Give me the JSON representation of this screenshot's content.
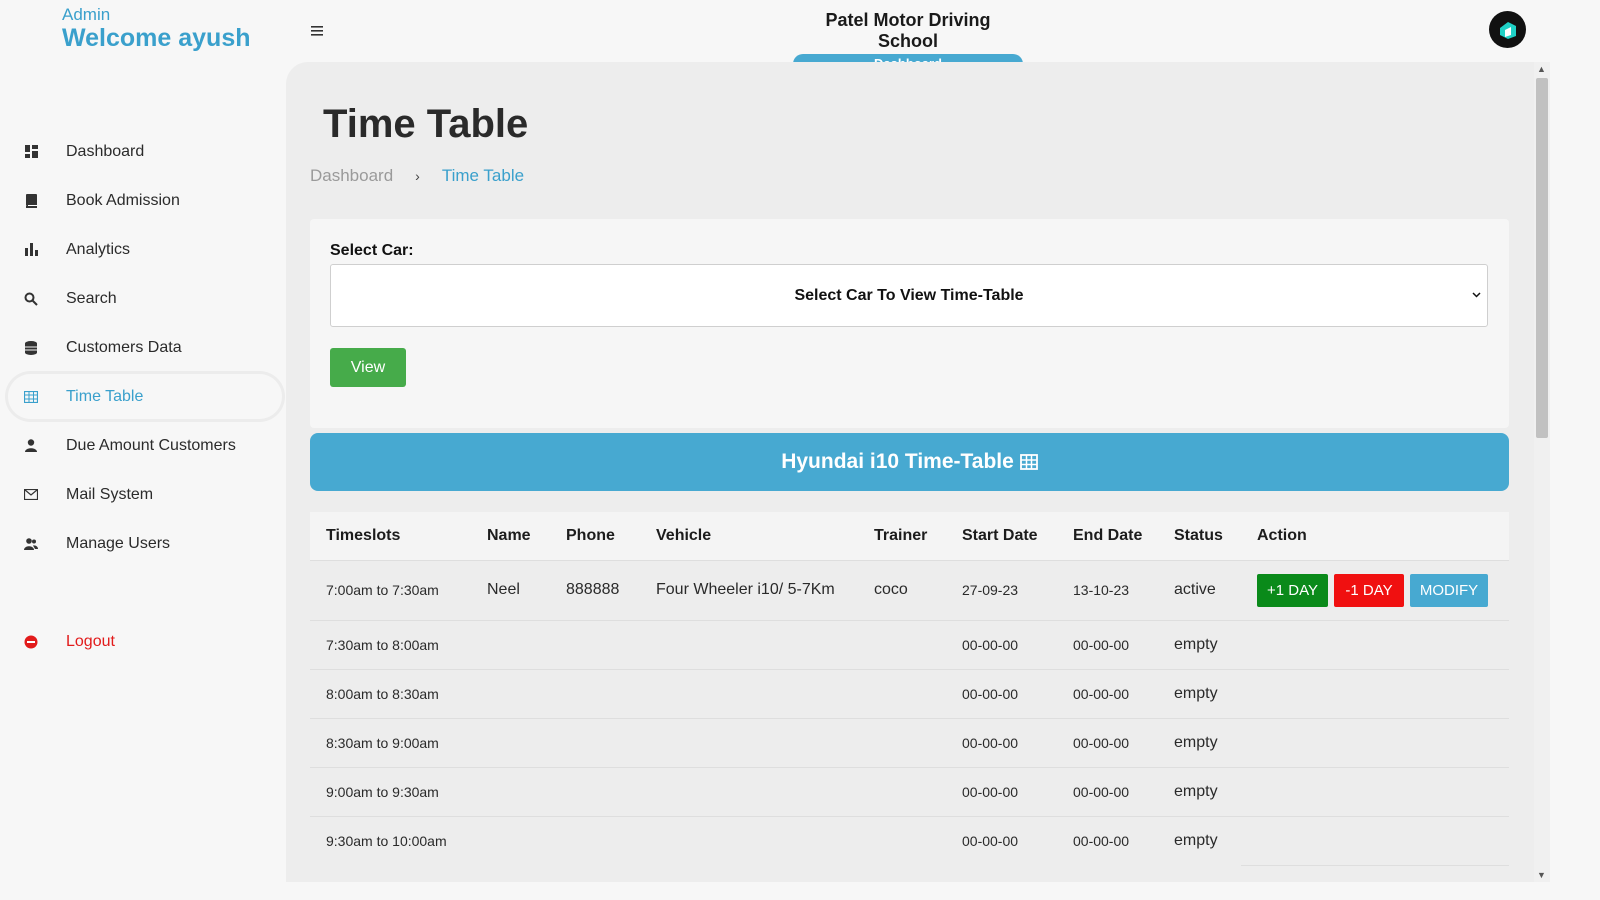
{
  "sidebar": {
    "role": "Admin",
    "welcome": "Welcome ayush",
    "items": [
      {
        "label": "Dashboard",
        "icon": "dashboard-icon"
      },
      {
        "label": "Book Admission",
        "icon": "book-icon"
      },
      {
        "label": "Analytics",
        "icon": "bar-chart-icon"
      },
      {
        "label": "Search",
        "icon": "search-icon"
      },
      {
        "label": "Customers Data",
        "icon": "database-icon"
      },
      {
        "label": "Time Table",
        "icon": "table-icon",
        "active": true
      },
      {
        "label": "Due Amount Customers",
        "icon": "person-icon"
      },
      {
        "label": "Mail System",
        "icon": "mail-icon"
      },
      {
        "label": "Manage Users",
        "icon": "users-icon"
      }
    ],
    "logout": "Logout"
  },
  "header": {
    "brand_title": "Patel Motor Driving School",
    "brand_sub": "Dashboard"
  },
  "main": {
    "page_title": "Time Table",
    "breadcrumb": [
      "Dashboard",
      "Time Table"
    ],
    "select_label": "Select Car:",
    "select_value": "Select Car To View Time-Table",
    "view_button": "View",
    "banner_title": "Hyundai i10 Time-Table"
  },
  "table": {
    "headers": [
      "Timeslots",
      "Name",
      "Phone",
      "Vehicle",
      "Trainer",
      "Start Date",
      "End Date",
      "Status",
      "Action"
    ],
    "rows": [
      {
        "slot": "7:00am to 7:30am",
        "name": "Neel",
        "phone": "888888",
        "vehicle": "Four Wheeler i10/ 5-7Km",
        "trainer": "coco",
        "start": "27-09-23",
        "end": "13-10-23",
        "status": "active",
        "actions": [
          "+1 DAY",
          "-1 DAY",
          "MODIFY"
        ]
      },
      {
        "slot": "7:30am to 8:00am",
        "name": "",
        "phone": "",
        "vehicle": "",
        "trainer": "",
        "start": "00-00-00",
        "end": "00-00-00",
        "status": "empty"
      },
      {
        "slot": "8:00am to 8:30am",
        "name": "",
        "phone": "",
        "vehicle": "",
        "trainer": "",
        "start": "00-00-00",
        "end": "00-00-00",
        "status": "empty"
      },
      {
        "slot": "8:30am to 9:00am",
        "name": "",
        "phone": "",
        "vehicle": "",
        "trainer": "",
        "start": "00-00-00",
        "end": "00-00-00",
        "status": "empty"
      },
      {
        "slot": "9:00am to 9:30am",
        "name": "",
        "phone": "",
        "vehicle": "",
        "trainer": "",
        "start": "00-00-00",
        "end": "00-00-00",
        "status": "empty"
      },
      {
        "slot": "9:30am to 10:00am",
        "name": "",
        "phone": "",
        "vehicle": "",
        "trainer": "",
        "start": "00-00-00",
        "end": "00-00-00",
        "status": "empty"
      }
    ]
  },
  "colors": {
    "accent": "#47a9d1",
    "success": "#0a8a1a",
    "danger": "#f01010",
    "view_button": "#46ab4a",
    "logout": "#e21b1b"
  }
}
